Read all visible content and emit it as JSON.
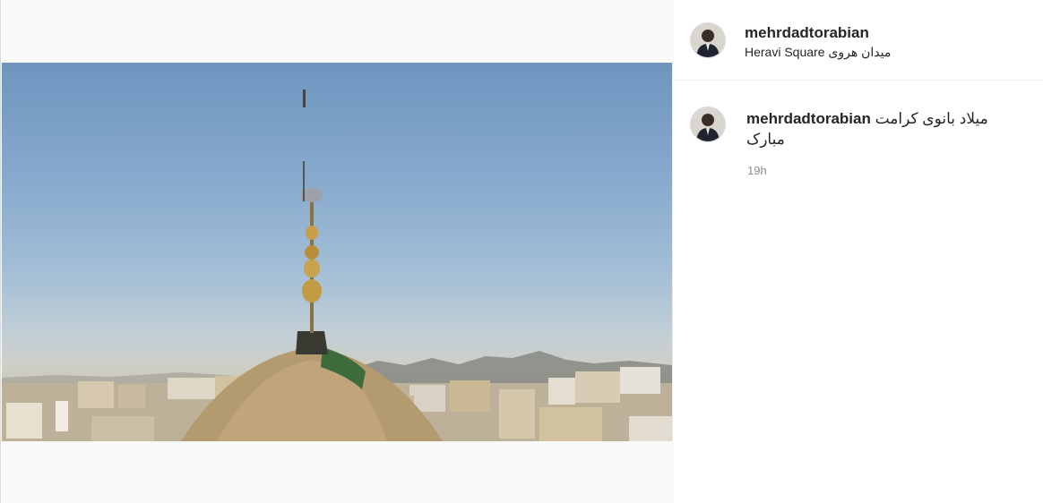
{
  "post": {
    "username": "mehrdadtorabian",
    "location": "Heravi Square میدان هروی",
    "caption_text": "میلاد بانوی کرامت مبارک",
    "time": "19h"
  },
  "video": {
    "muted_icon": "speaker-muted-icon"
  }
}
